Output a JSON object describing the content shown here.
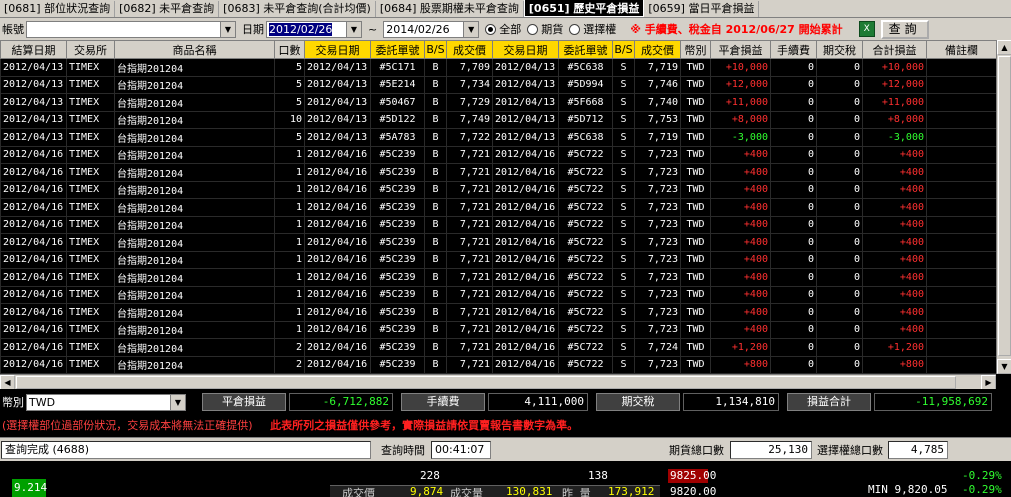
{
  "tabs": [
    {
      "label": "[0681] 部位狀況查詢",
      "active": false
    },
    {
      "label": "[0682] 未平倉查詢",
      "active": false
    },
    {
      "label": "[0683] 未平倉查詢(合計均價)",
      "active": false
    },
    {
      "label": "[0684] 股票期權未平倉查詢",
      "active": false
    },
    {
      "label": "[0651] 歷史平倉損益",
      "active": true
    },
    {
      "label": "[0659] 當日平倉損益",
      "active": false
    }
  ],
  "filter": {
    "account_label": "帳號",
    "account_value": "",
    "date_label": "日期",
    "date_from": "2012/02/26",
    "date_sep": "~",
    "date_to": "2014/02/26",
    "radio_all": "全部",
    "radio_futures": "期貨",
    "radio_options": "選擇權",
    "notice": "※ 手續費、稅金自 2012/06/27 開始累計",
    "query_button": "查詢"
  },
  "grid": {
    "headers": [
      "結算日期",
      "交易所",
      "商品名稱",
      "口數",
      "交易日期",
      "委託單號",
      "B/S",
      "成交價",
      "交易日期",
      "委託單號",
      "B/S",
      "成交價",
      "幣別",
      "平倉損益",
      "手續費",
      "期交稅",
      "合計損益",
      "備註欄"
    ],
    "rows": [
      [
        "2012/04/13",
        "TIMEX",
        "台指期201204",
        "5",
        "2012/04/13",
        "#5C171",
        "B",
        "7,709",
        "2012/04/13",
        "#5C638",
        "S",
        "7,719",
        "TWD",
        "+10,000",
        "0",
        "0",
        "+10,000",
        ""
      ],
      [
        "2012/04/13",
        "TIMEX",
        "台指期201204",
        "5",
        "2012/04/13",
        "#5E214",
        "B",
        "7,734",
        "2012/04/13",
        "#5D994",
        "S",
        "7,746",
        "TWD",
        "+12,000",
        "0",
        "0",
        "+12,000",
        ""
      ],
      [
        "2012/04/13",
        "TIMEX",
        "台指期201204",
        "5",
        "2012/04/13",
        "#50467",
        "B",
        "7,729",
        "2012/04/13",
        "#5F668",
        "S",
        "7,740",
        "TWD",
        "+11,000",
        "0",
        "0",
        "+11,000",
        ""
      ],
      [
        "2012/04/13",
        "TIMEX",
        "台指期201204",
        "10",
        "2012/04/13",
        "#5D122",
        "B",
        "7,749",
        "2012/04/13",
        "#5D712",
        "S",
        "7,753",
        "TWD",
        "+8,000",
        "0",
        "0",
        "+8,000",
        ""
      ],
      [
        "2012/04/13",
        "TIMEX",
        "台指期201204",
        "5",
        "2012/04/13",
        "#5A783",
        "B",
        "7,722",
        "2012/04/13",
        "#5C638",
        "S",
        "7,719",
        "TWD",
        "-3,000",
        "0",
        "0",
        "-3,000",
        ""
      ],
      [
        "2012/04/16",
        "TIMEX",
        "台指期201204",
        "1",
        "2012/04/16",
        "#5C239",
        "B",
        "7,721",
        "2012/04/16",
        "#5C722",
        "S",
        "7,723",
        "TWD",
        "+400",
        "0",
        "0",
        "+400",
        ""
      ],
      [
        "2012/04/16",
        "TIMEX",
        "台指期201204",
        "1",
        "2012/04/16",
        "#5C239",
        "B",
        "7,721",
        "2012/04/16",
        "#5C722",
        "S",
        "7,723",
        "TWD",
        "+400",
        "0",
        "0",
        "+400",
        ""
      ],
      [
        "2012/04/16",
        "TIMEX",
        "台指期201204",
        "1",
        "2012/04/16",
        "#5C239",
        "B",
        "7,721",
        "2012/04/16",
        "#5C722",
        "S",
        "7,723",
        "TWD",
        "+400",
        "0",
        "0",
        "+400",
        ""
      ],
      [
        "2012/04/16",
        "TIMEX",
        "台指期201204",
        "1",
        "2012/04/16",
        "#5C239",
        "B",
        "7,721",
        "2012/04/16",
        "#5C722",
        "S",
        "7,723",
        "TWD",
        "+400",
        "0",
        "0",
        "+400",
        ""
      ],
      [
        "2012/04/16",
        "TIMEX",
        "台指期201204",
        "1",
        "2012/04/16",
        "#5C239",
        "B",
        "7,721",
        "2012/04/16",
        "#5C722",
        "S",
        "7,723",
        "TWD",
        "+400",
        "0",
        "0",
        "+400",
        ""
      ],
      [
        "2012/04/16",
        "TIMEX",
        "台指期201204",
        "1",
        "2012/04/16",
        "#5C239",
        "B",
        "7,721",
        "2012/04/16",
        "#5C722",
        "S",
        "7,723",
        "TWD",
        "+400",
        "0",
        "0",
        "+400",
        ""
      ],
      [
        "2012/04/16",
        "TIMEX",
        "台指期201204",
        "1",
        "2012/04/16",
        "#5C239",
        "B",
        "7,721",
        "2012/04/16",
        "#5C722",
        "S",
        "7,723",
        "TWD",
        "+400",
        "0",
        "0",
        "+400",
        ""
      ],
      [
        "2012/04/16",
        "TIMEX",
        "台指期201204",
        "1",
        "2012/04/16",
        "#5C239",
        "B",
        "7,721",
        "2012/04/16",
        "#5C722",
        "S",
        "7,723",
        "TWD",
        "+400",
        "0",
        "0",
        "+400",
        ""
      ],
      [
        "2012/04/16",
        "TIMEX",
        "台指期201204",
        "1",
        "2012/04/16",
        "#5C239",
        "B",
        "7,721",
        "2012/04/16",
        "#5C722",
        "S",
        "7,723",
        "TWD",
        "+400",
        "0",
        "0",
        "+400",
        ""
      ],
      [
        "2012/04/16",
        "TIMEX",
        "台指期201204",
        "1",
        "2012/04/16",
        "#5C239",
        "B",
        "7,721",
        "2012/04/16",
        "#5C722",
        "S",
        "7,723",
        "TWD",
        "+400",
        "0",
        "0",
        "+400",
        ""
      ],
      [
        "2012/04/16",
        "TIMEX",
        "台指期201204",
        "1",
        "2012/04/16",
        "#5C239",
        "B",
        "7,721",
        "2012/04/16",
        "#5C722",
        "S",
        "7,723",
        "TWD",
        "+400",
        "0",
        "0",
        "+400",
        ""
      ],
      [
        "2012/04/16",
        "TIMEX",
        "台指期201204",
        "2",
        "2012/04/16",
        "#5C239",
        "B",
        "7,721",
        "2012/04/16",
        "#5C722",
        "S",
        "7,724",
        "TWD",
        "+1,200",
        "0",
        "0",
        "+1,200",
        ""
      ],
      [
        "2012/04/16",
        "TIMEX",
        "台指期201204",
        "2",
        "2012/04/16",
        "#5C239",
        "B",
        "7,721",
        "2012/04/16",
        "#5C722",
        "S",
        "7,723",
        "TWD",
        "+800",
        "0",
        "0",
        "+800",
        ""
      ]
    ]
  },
  "summary": {
    "currency_label": "幣別",
    "currency_value": "TWD",
    "pnl_label": "平倉損益",
    "pnl_value": "-6,712,882",
    "fee_label": "手續費",
    "fee_value": "4,111,000",
    "tax_label": "期交稅",
    "tax_value": "1,134,810",
    "total_label": "損益合計",
    "total_value": "-11,958,692"
  },
  "warning": {
    "note": "(選擇權部位過部份狀況，交易成本將無法正確提供)",
    "disclaimer": "此表所列之損益僅供參考，實際損益請依買賣報告書數字為準。"
  },
  "status": {
    "message": "查詢完成 (4688)",
    "time_label": "查詢時間",
    "time_value": "00:41:07",
    "fut_label": "期貨總口數",
    "fut_value": "25,130",
    "opt_label": "選擇權總口數",
    "opt_value": "4,785"
  },
  "quote": {
    "left_price": "9.214",
    "v1": "228",
    "v2": "138",
    "v3": "9825.00",
    "pct_top": "-0.29%",
    "deal_label": "成交價",
    "deal_price": "9,874",
    "vol_label": "成交量",
    "vol_value": "130,831",
    "prev_label": "昨 量",
    "prev_value": "173,912",
    "v4": "9820.00",
    "min_label": "MIN 9,820.05",
    "pct_bottom": "-0.29%"
  }
}
